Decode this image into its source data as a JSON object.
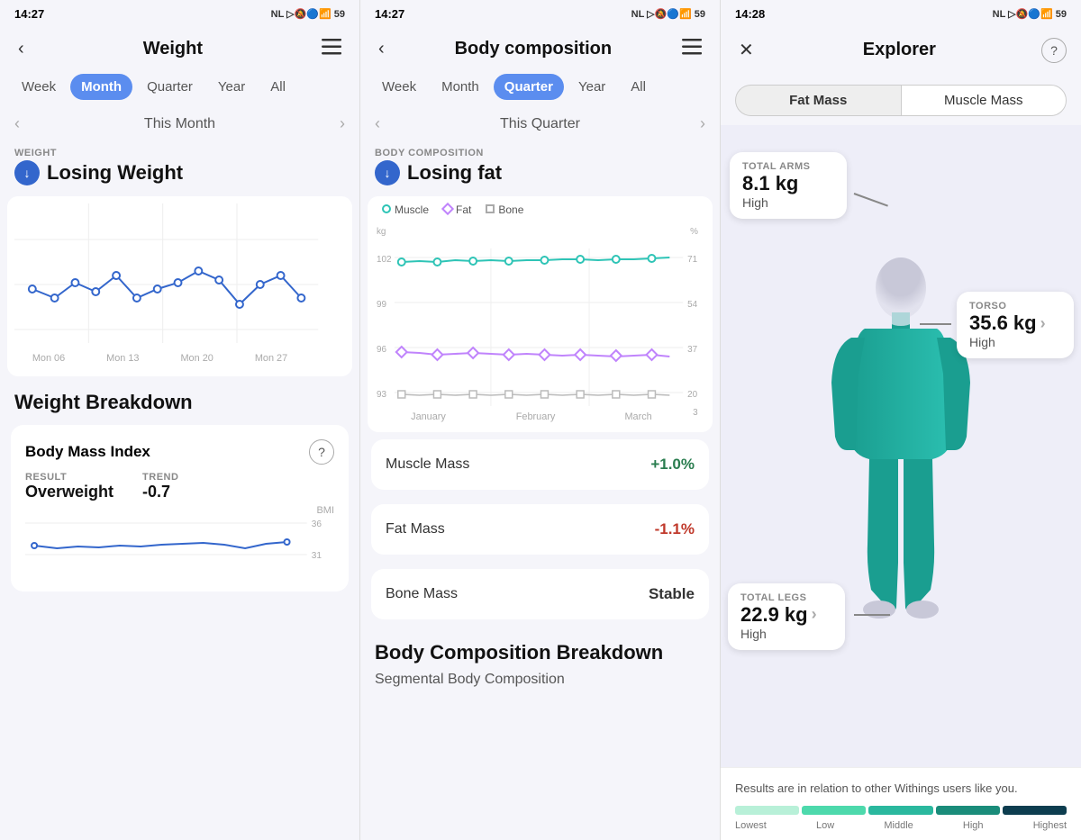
{
  "panel1": {
    "statusBar": {
      "time": "14:27",
      "icons": "NL ◁☰ ☆ ||||| 59"
    },
    "header": {
      "title": "Weight",
      "backLabel": "‹",
      "menuLabel": "☰"
    },
    "tabs": [
      "Week",
      "Month",
      "Quarter",
      "Year",
      "All"
    ],
    "activeTab": "Month",
    "nav": {
      "label": "This Month",
      "prevLabel": "‹",
      "nextLabel": "›"
    },
    "section": {
      "label": "WEIGHT",
      "status": "Losing Weight"
    },
    "chartXLabels": [
      "Mon 06",
      "Mon 13",
      "Mon 20",
      "Mon 27"
    ],
    "breakdown": {
      "title": "Weight Breakdown",
      "bmi": {
        "title": "Body Mass Index",
        "resultLabel": "RESULT",
        "resultValue": "Overweight",
        "trendLabel": "TREND",
        "trendValue": "-0.7",
        "yLabel": "BMI",
        "yValues": [
          "36",
          "31"
        ]
      }
    }
  },
  "panel2": {
    "statusBar": {
      "time": "14:27",
      "icons": "NL ◁☰ ☆ ||||| 59"
    },
    "header": {
      "title": "Body composition",
      "backLabel": "‹",
      "menuLabel": "☰"
    },
    "tabs": [
      "Week",
      "Month",
      "Quarter",
      "Year",
      "All"
    ],
    "activeTab": "Quarter",
    "nav": {
      "label": "This Quarter",
      "prevLabel": "‹",
      "nextLabel": "›"
    },
    "section": {
      "label": "BODY COMPOSITION",
      "status": "Losing fat"
    },
    "chart": {
      "yLeftLabel": "kg",
      "yRightLabel": "%",
      "yLeftValues": [
        "102",
        "99",
        "96",
        "93"
      ],
      "yRightValues": [
        "71",
        "54",
        "37",
        "20",
        "3"
      ],
      "xLabels": [
        "January",
        "February",
        "March"
      ],
      "legend": [
        {
          "type": "dot",
          "color": "#2ec4b6",
          "label": "Muscle"
        },
        {
          "type": "diamond",
          "color": "#c084fc",
          "label": "Fat"
        },
        {
          "type": "square",
          "color": "#aaa",
          "label": "Bone"
        }
      ]
    },
    "stats": [
      {
        "label": "Muscle Mass",
        "value": "+1.0%",
        "type": "pos"
      },
      {
        "label": "Fat Mass",
        "value": "-1.1%",
        "type": "neg"
      },
      {
        "label": "Bone Mass",
        "value": "Stable",
        "type": "stable"
      }
    ],
    "breakdownTitle": "Body Composition Breakdown",
    "breakdownSub": "Segmental Body Composition"
  },
  "panel3": {
    "statusBar": {
      "time": "14:28",
      "icons": "NL ◁☰ ☆ ||||| 59"
    },
    "header": {
      "title": "Explorer",
      "closeLabel": "✕",
      "helpLabel": "?"
    },
    "toggles": [
      "Fat Mass",
      "Muscle Mass"
    ],
    "activeToggle": "Fat Mass",
    "bubbles": [
      {
        "id": "arms",
        "label": "TOTAL ARMS",
        "value": "8.1 kg",
        "sub": "High",
        "hasArrow": false
      },
      {
        "id": "torso",
        "label": "TORSO",
        "value": "35.6 kg",
        "sub": "High",
        "hasArrow": true
      },
      {
        "id": "legs",
        "label": "TOTAL LEGS",
        "value": "22.9 kg",
        "sub": "High",
        "hasArrow": true
      }
    ],
    "legend": {
      "text": "Results are in relation to other Withings users like you.",
      "labels": [
        "Lowest",
        "Low",
        "Middle",
        "High",
        "Highest"
      ],
      "colors": [
        "#b8f0d8",
        "#4dd9ac",
        "#2ab89e",
        "#1a8c7a",
        "#0d3d4f"
      ]
    }
  }
}
